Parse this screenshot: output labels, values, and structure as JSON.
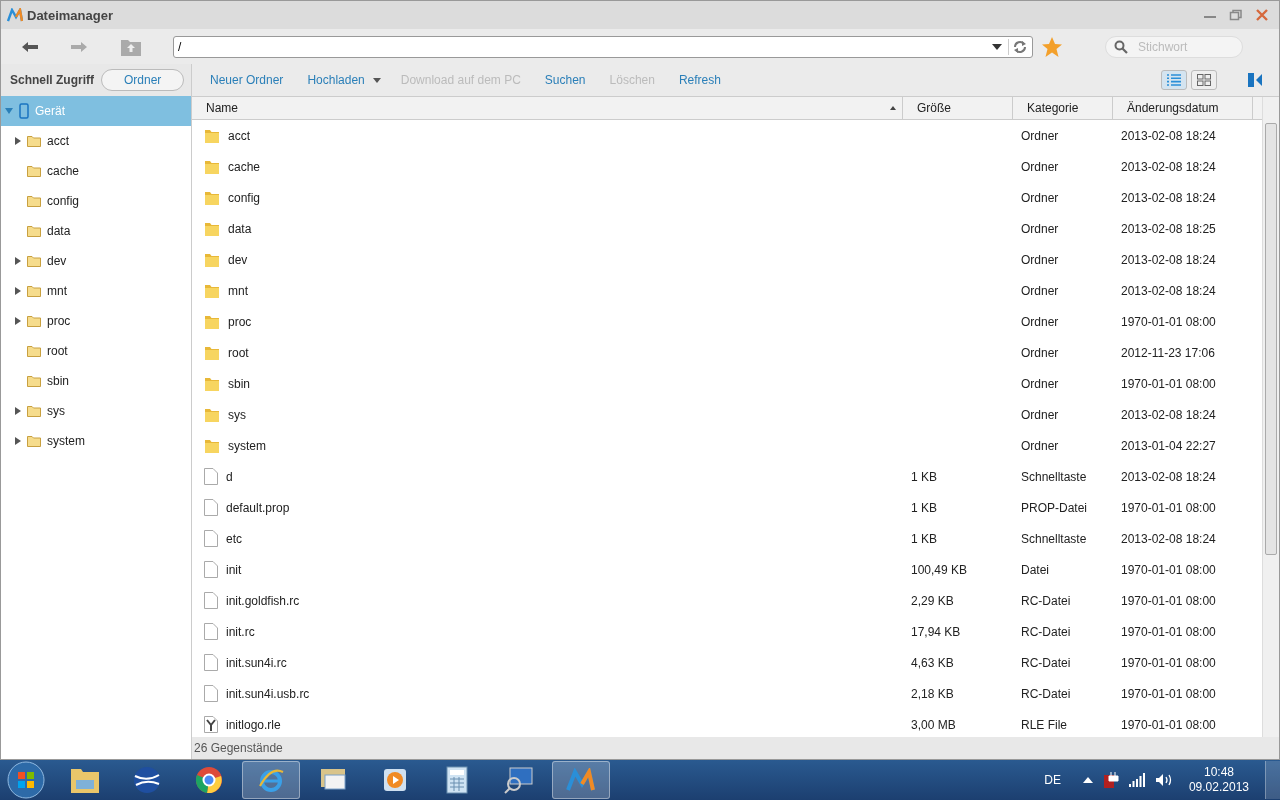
{
  "window": {
    "title": "Dateimanager"
  },
  "path_field": {
    "value": "/"
  },
  "search": {
    "placeholder": "Stichwort"
  },
  "panel_tabs": [
    {
      "label": "Schnell Zugriff",
      "selected": false
    },
    {
      "label": "Ordner",
      "selected": true
    }
  ],
  "actions": [
    {
      "label": "Neuer Ordner",
      "kind": "plain",
      "disabled": false
    },
    {
      "label": "Hochladen",
      "kind": "dropdown",
      "disabled": false
    },
    {
      "label": "Download auf dem PC",
      "kind": "plain",
      "disabled": true
    },
    {
      "label": "Suchen",
      "kind": "plain",
      "disabled": false
    },
    {
      "label": "Löschen",
      "kind": "plain",
      "disabled": true
    },
    {
      "label": "Refresh",
      "kind": "plain",
      "disabled": false
    }
  ],
  "views": [
    {
      "kind": "list",
      "selected": true
    },
    {
      "kind": "grid",
      "selected": false
    }
  ],
  "sidebar": {
    "items": [
      {
        "label": "Gerät",
        "selected": true,
        "expanded": true,
        "children": [
          {
            "label": "acct",
            "expandable": true
          },
          {
            "label": "cache",
            "expandable": false
          },
          {
            "label": "config",
            "expandable": false
          },
          {
            "label": "data",
            "expandable": false
          },
          {
            "label": "dev",
            "expandable": true
          },
          {
            "label": "mnt",
            "expandable": true
          },
          {
            "label": "proc",
            "expandable": true
          },
          {
            "label": "root",
            "expandable": false
          },
          {
            "label": "sbin",
            "expandable": false
          },
          {
            "label": "sys",
            "expandable": true
          },
          {
            "label": "system",
            "expandable": true
          }
        ]
      }
    ]
  },
  "table": {
    "columns": [
      {
        "label": "Name",
        "sorted": true
      },
      {
        "label": "Größe",
        "sorted": false
      },
      {
        "label": "Kategorie",
        "sorted": false
      },
      {
        "label": "Änderungsdatum",
        "sorted": false
      }
    ],
    "rows": [
      {
        "kind": "folder",
        "name": "acct",
        "size": "",
        "category": "Ordner",
        "date": "2013-02-08 18:24"
      },
      {
        "kind": "folder",
        "name": "cache",
        "size": "",
        "category": "Ordner",
        "date": "2013-02-08 18:24"
      },
      {
        "kind": "folder",
        "name": "config",
        "size": "",
        "category": "Ordner",
        "date": "2013-02-08 18:24"
      },
      {
        "kind": "folder",
        "name": "data",
        "size": "",
        "category": "Ordner",
        "date": "2013-02-08 18:25"
      },
      {
        "kind": "folder",
        "name": "dev",
        "size": "",
        "category": "Ordner",
        "date": "2013-02-08 18:24"
      },
      {
        "kind": "folder",
        "name": "mnt",
        "size": "",
        "category": "Ordner",
        "date": "2013-02-08 18:24"
      },
      {
        "kind": "folder",
        "name": "proc",
        "size": "",
        "category": "Ordner",
        "date": "1970-01-01 08:00"
      },
      {
        "kind": "folder",
        "name": "root",
        "size": "",
        "category": "Ordner",
        "date": "2012-11-23 17:06"
      },
      {
        "kind": "folder",
        "name": "sbin",
        "size": "",
        "category": "Ordner",
        "date": "1970-01-01 08:00"
      },
      {
        "kind": "folder",
        "name": "sys",
        "size": "",
        "category": "Ordner",
        "date": "2013-02-08 18:24"
      },
      {
        "kind": "folder",
        "name": "system",
        "size": "",
        "category": "Ordner",
        "date": "2013-01-04 22:27"
      },
      {
        "kind": "file",
        "name": "d",
        "size": "1 KB",
        "category": "Schnelltaste",
        "date": "2013-02-08 18:24"
      },
      {
        "kind": "file",
        "name": "default.prop",
        "size": "1 KB",
        "category": "PROP-Datei",
        "date": "1970-01-01 08:00"
      },
      {
        "kind": "file",
        "name": "etc",
        "size": "1 KB",
        "category": "Schnelltaste",
        "date": "2013-02-08 18:24"
      },
      {
        "kind": "file",
        "name": "init",
        "size": "100,49 KB",
        "category": "Datei",
        "date": "1970-01-01 08:00"
      },
      {
        "kind": "file",
        "name": "init.goldfish.rc",
        "size": "2,29 KB",
        "category": "RC-Datei",
        "date": "1970-01-01 08:00"
      },
      {
        "kind": "file",
        "name": "init.rc",
        "size": "17,94 KB",
        "category": "RC-Datei",
        "date": "1970-01-01 08:00"
      },
      {
        "kind": "file",
        "name": "init.sun4i.rc",
        "size": "4,63 KB",
        "category": "RC-Datei",
        "date": "1970-01-01 08:00"
      },
      {
        "kind": "file",
        "name": "init.sun4i.usb.rc",
        "size": "2,18 KB",
        "category": "RC-Datei",
        "date": "1970-01-01 08:00"
      },
      {
        "kind": "image",
        "name": "initlogo.rle",
        "size": "3,00 MB",
        "category": "RLE File",
        "date": "1970-01-01 08:00"
      }
    ]
  },
  "status_bar": {
    "count": "26 Gegenstände"
  },
  "taskbar": {
    "apps": [
      {
        "kind": "folder",
        "selected": false
      },
      {
        "kind": "globe",
        "selected": false
      },
      {
        "kind": "chrome",
        "selected": false
      },
      {
        "kind": "browser",
        "selected": true
      },
      {
        "kind": "mail",
        "selected": false
      },
      {
        "kind": "media",
        "selected": false
      },
      {
        "kind": "calculator",
        "selected": false
      },
      {
        "kind": "monitor",
        "selected": false
      },
      {
        "kind": "filemanager",
        "selected": true
      }
    ],
    "language": "DE",
    "time": "10:48",
    "date": "09.02.2013"
  }
}
